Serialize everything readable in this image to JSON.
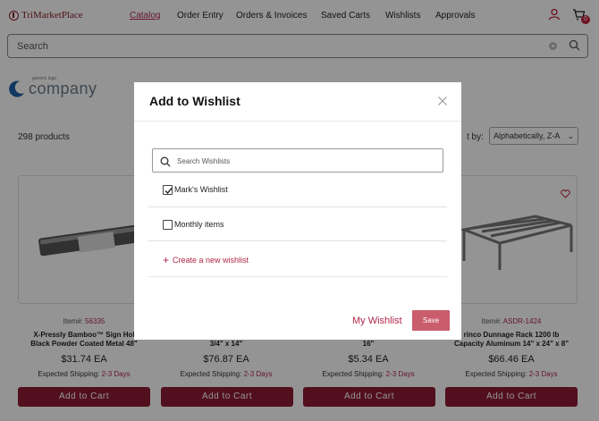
{
  "header": {
    "logo_text": "TriMarketPlace",
    "nav": [
      "Catalog",
      "Order Entry",
      "Orders & Invoices",
      "Saved Carts",
      "Wishlists",
      "Approvals"
    ],
    "cart_count": "0"
  },
  "search": {
    "placeholder": "Search"
  },
  "brand": {
    "small": "generic logo",
    "name": "company"
  },
  "listing": {
    "count": "298 products",
    "sort_label": "t by:",
    "sort_value": "Alphabetically, Z-A"
  },
  "products": [
    {
      "item_label": "Item#:",
      "item_num": "56335",
      "name": "X-Pressly Bamboo™ Sign Hol\nBlack Powder Coated Metal 48\"",
      "price": "$31.74 EA",
      "ship_label": "Expected Shipping:",
      "ship_days": "2-3 Days",
      "button": "Add to Cart"
    },
    {
      "name": "3/4\" x 14\"",
      "price": "$76.87 EA",
      "ship_label": "Expected Shipping:",
      "ship_days": "2-3 Days",
      "button": "Add to Cart"
    },
    {
      "name": "16\"",
      "price": "$5.34 EA",
      "ship_label": "Expected Shipping:",
      "ship_days": "2-3 Days",
      "button": "Add to Cart"
    },
    {
      "item_label": "Item#:",
      "item_num": "ASDR-1424",
      "name": "rinco Dunnage Rack 1200 lb\nCapacity Aluminum 14\" x 24\" x 8\"",
      "price": "$66.46 EA",
      "ship_label": "Expected Shipping:",
      "ship_days": "2-3 Days",
      "button": "Add to Cart"
    }
  ],
  "modal": {
    "title": "Add to Wishlist",
    "search_placeholder": "Search Wishlists",
    "wishlists": [
      {
        "label": "Mark's Wishlist",
        "checked": true
      },
      {
        "label": "Monthly items",
        "checked": false
      }
    ],
    "create_label": "Create a new wishlist",
    "my_wishlist": "My Wishlist",
    "save": "Save"
  },
  "colors": {
    "accent": "#b0264a",
    "button": "#8e1b33",
    "save": "#c95d6c"
  }
}
